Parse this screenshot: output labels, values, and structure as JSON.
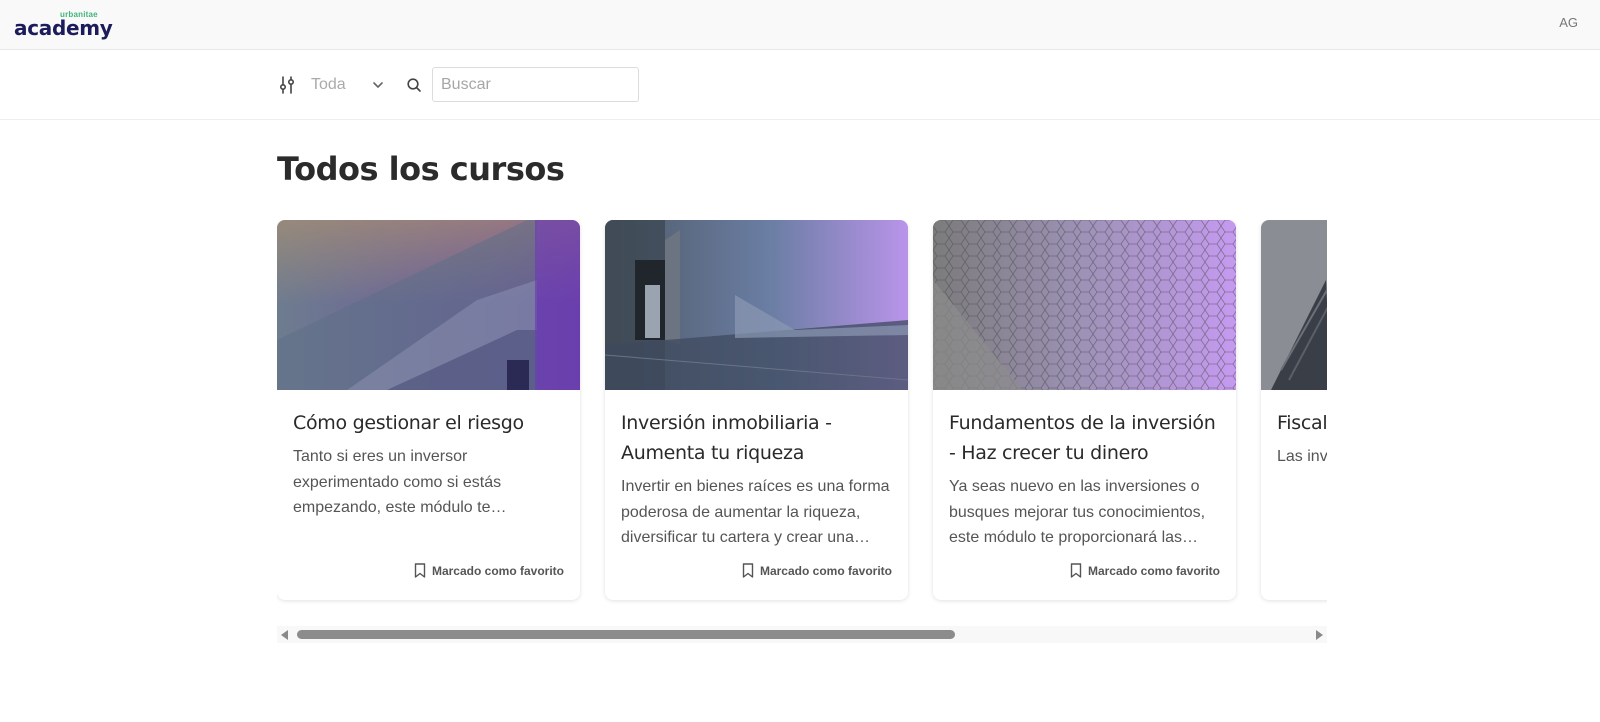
{
  "header": {
    "brand_small": "urbanitae",
    "brand_main": "academy",
    "avatar_initials": "AG"
  },
  "filters": {
    "category_value": "Toda",
    "search_placeholder": "Buscar",
    "search_value": ""
  },
  "main": {
    "title": "Todos los cursos"
  },
  "courses": [
    {
      "title": "Cómo gestionar el riesgo",
      "description": "Tanto si eres un inversor experimentado como si estás empezando, este módulo te permitirá…",
      "favorite_label": "Marcado como favorito"
    },
    {
      "title": "Inversión inmobiliaria - Aumenta tu riqueza",
      "description": "Invertir en bienes raíces es una forma poderosa de aumentar la riqueza, diversificar tu cartera y crear una…",
      "favorite_label": "Marcado como favorito"
    },
    {
      "title": "Fundamentos de la inversión - Haz crecer tu dinero",
      "description": "Ya seas nuevo en las inversiones o busques mejorar tus conocimientos, este módulo te proporcionará las…",
      "favorite_label": "Marcado como favorito"
    },
    {
      "title": "Fiscal Invers",
      "description": "Las inv certeza No imp",
      "favorite_label": ""
    }
  ],
  "colors": {
    "brand_navy": "#1c1c5c",
    "brand_green": "#3fb57a",
    "card_gradient_purple": "#b48ae6"
  },
  "scrollbar": {
    "position_fraction": 0.0,
    "visible_fraction": 0.63
  }
}
